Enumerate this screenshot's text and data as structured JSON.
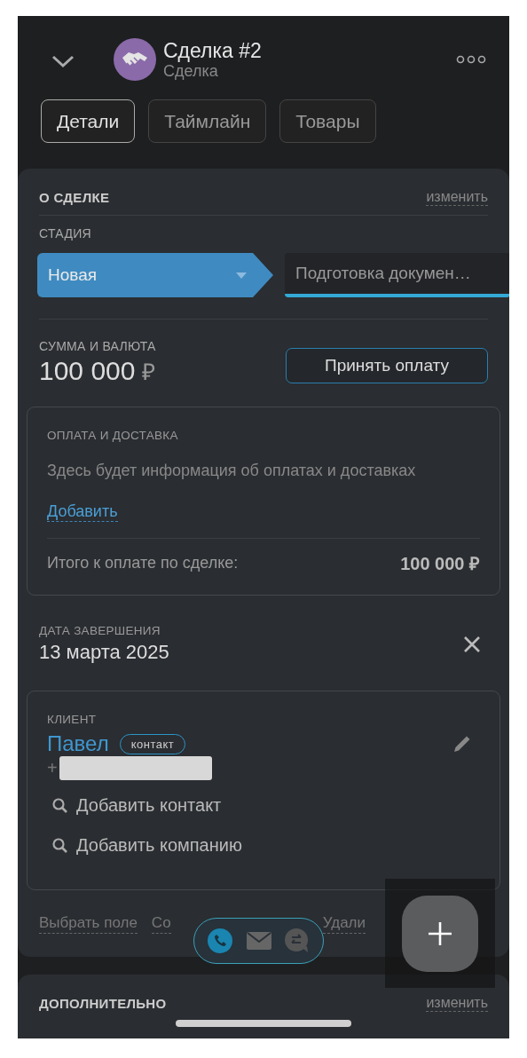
{
  "header": {
    "title": "Сделка #2",
    "subtitle": "Сделка"
  },
  "tabs": [
    {
      "label": "Детали",
      "selected": true
    },
    {
      "label": "Таймлайн",
      "selected": false
    },
    {
      "label": "Товары",
      "selected": false
    }
  ],
  "deal_section": {
    "title": "О СДЕЛКЕ",
    "edit_link": "изменить",
    "stage": {
      "label": "СТАДИЯ",
      "stages": [
        {
          "name": "Новая",
          "selected": true
        },
        {
          "name": "Подготовка докумен…",
          "selected": false
        }
      ]
    },
    "amount": {
      "label": "СУММА И ВАЛЮТА",
      "value": "100 000",
      "currency": "₽",
      "button": "Принять оплату"
    },
    "payment": {
      "title": "ОПЛАТА И ДОСТАВКА",
      "empty_text": "Здесь будет информация об оплатах и доставках",
      "add_link": "Добавить",
      "total_label": "Итого к оплате по сделке:",
      "total_value": "100 000 ₽"
    },
    "close_date": {
      "label": "ДАТА ЗАВЕРШЕНИЯ",
      "value": "13 марта 2025"
    },
    "client": {
      "label": "КЛИЕНТ",
      "name": "Павел",
      "tag": "контакт",
      "phone_prefix": "+",
      "actions": [
        "Добавить контакт",
        "Добавить компанию"
      ]
    },
    "footer_links": [
      "Выбрать поле",
      "Со",
      "Удали"
    ]
  },
  "additional_section": {
    "title": "ДОПОЛНИТЕЛЬНО",
    "edit_link": "изменить"
  }
}
